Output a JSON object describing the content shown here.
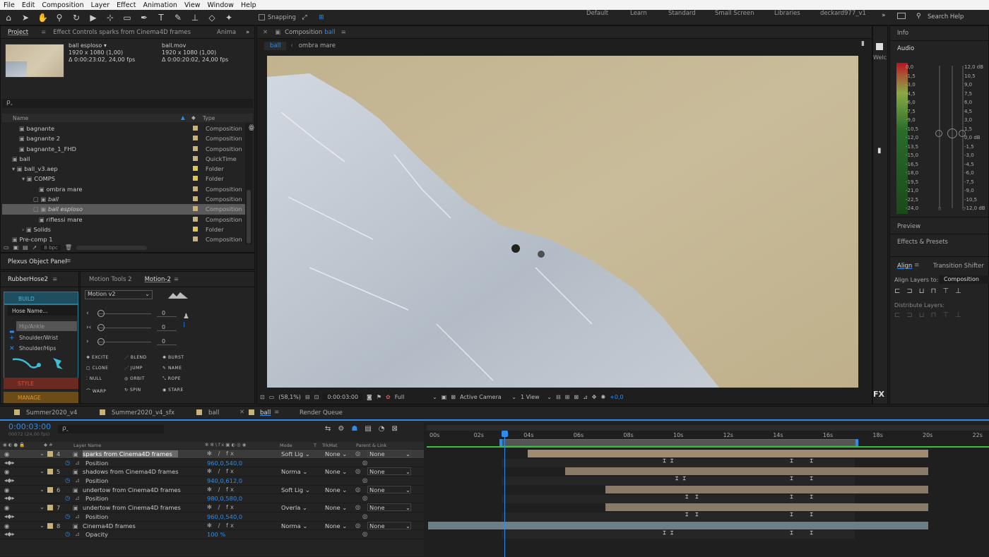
{
  "menu": [
    "File",
    "Edit",
    "Composition",
    "Layer",
    "Effect",
    "Animation",
    "View",
    "Window",
    "Help"
  ],
  "toolbar": {
    "snapping": "Snapping",
    "workspaces": [
      "Default",
      "Learn",
      "Standard",
      "Small Screen",
      "Libraries",
      "deckard977_v1"
    ],
    "search": "Search Help"
  },
  "project": {
    "tab": "Project",
    "effect_tab": "Effect Controls sparks from Cinema4D frames",
    "anim_tab": "Anima",
    "item1": {
      "name": "ball esploso ▾",
      "dims": "1920 x 1080 (1,00)",
      "dur": "Δ 0:00:23:02, 24,00 fps"
    },
    "item2": {
      "name": "ball.mov",
      "dims": "1920 x 1080 (1,00)",
      "dur": "Δ 0:00:20:02, 24,00 fps"
    },
    "search": "ρ‸",
    "col_name": "Name",
    "col_type": "Type",
    "bpc": "8 bpc",
    "rows": [
      {
        "name": "bagnante",
        "type": "Composition",
        "color": "#c7b27a"
      },
      {
        "name": "bagnante 2",
        "type": "Composition",
        "color": "#c7b27a"
      },
      {
        "name": "bagnante_1_FHD",
        "type": "Composition",
        "color": "#c7b27a"
      },
      {
        "name": "ball",
        "type": "QuickTime",
        "color": "#c7b27a"
      },
      {
        "name": "ball_v3.aep",
        "type": "Folder",
        "color": "#e2c54a"
      },
      {
        "name": "COMPS",
        "type": "Folder",
        "color": "#e2c54a"
      },
      {
        "name": "ombra mare",
        "type": "Composition",
        "color": "#c7b27a"
      },
      {
        "name": "ball",
        "type": "Composition",
        "color": "#c7b27a"
      },
      {
        "name": "ball esploso",
        "type": "Composition",
        "color": "#c7b27a"
      },
      {
        "name": "riflessi mare",
        "type": "Composition",
        "color": "#c7b27a"
      },
      {
        "name": "Solids",
        "type": "Folder",
        "color": "#e2c54a"
      },
      {
        "name": "Pre-comp 1",
        "type": "Composition",
        "color": "#c7b27a"
      }
    ]
  },
  "plexus": {
    "title": "Plexus Object Panel"
  },
  "rubberhose": {
    "tab": "RubberHose2",
    "build": "BUILD",
    "hose_name": "Hose Name...",
    "hip": "Hip/Ankle",
    "shoulder_wrist": "Shoulder/Wrist",
    "shoulder_hips": "Shoulder/Hips",
    "style": "STYLE",
    "manage": "MANAGE"
  },
  "motion": {
    "tab1": "Motion Tools 2",
    "tab2": "Motion-2",
    "select": "Motion v2",
    "val1": "0",
    "val2": "0",
    "val3": "0",
    "buttons": [
      "EXCITE",
      "BLEND",
      "BURST",
      "CLONE",
      "JUMP",
      "NAME",
      "NULL",
      "ORBIT",
      "ROPE",
      "WARP",
      "SPIN",
      "STARE"
    ]
  },
  "composition": {
    "tab": "Composition",
    "tab_name": "ball",
    "crumb1": "ball",
    "crumb2": "ombra mare",
    "zoom": "(58,1%)",
    "time": "0:00:03:00",
    "quality": "Full",
    "camera": "Active Camera",
    "view": "1 View",
    "exposure": "+0,0"
  },
  "right": {
    "info": "Info",
    "audio": "Audio",
    "preview": "Preview",
    "effects": "Effects & Presets",
    "align": "Align",
    "transition": "Transition Shifter",
    "align_to_label": "Align Layers to:",
    "align_to": "Composition",
    "distribute": "Distribute Layers:",
    "welc": "Welc",
    "db_left": [
      "0,0",
      "-1,5",
      "-3,0",
      "-4,5",
      "-6,0",
      "-7,5",
      "-9,0",
      "-10,5",
      "-12,0",
      "-13,5",
      "-15,0",
      "-16,5",
      "-18,0",
      "-19,5",
      "-21,0",
      "-22,5",
      "-24,0"
    ],
    "db_right": [
      "12,0 dB",
      "10,5",
      "9,0",
      "7,5",
      "6,0",
      "4,5",
      "3,0",
      "1,5",
      "0,0 dB",
      "-1,5",
      "-3,0",
      "-4,5",
      "-6,0",
      "-7,5",
      "-9,0",
      "-10,5",
      "-12,0 dB"
    ],
    "slider_zero": "0"
  },
  "timeline": {
    "tabs": [
      "Summer2020_v4",
      "Summer2020_v4_sfx",
      "ball",
      "ball",
      "Render Queue"
    ],
    "time": "0:00:03:00",
    "frames": "00072 (24,00 fps)",
    "search": "ρ‸",
    "headers": {
      "layer": "Layer Name",
      "mode": "Mode",
      "t": "T",
      "trkmat": "TrkMat",
      "parent": "Parent & Link"
    },
    "ruler": [
      "00s",
      "02s",
      "04s",
      "06s",
      "08s",
      "10s",
      "12s",
      "14s",
      "16s",
      "18s",
      "20s",
      "22s"
    ],
    "layers": [
      {
        "num": "4",
        "name": "sparks from Cinema4D frames",
        "mode": "Soft Lig",
        "trkmat": "None",
        "parent": "None",
        "prop": "Position",
        "val": "960,0,540,0",
        "selected": true
      },
      {
        "num": "5",
        "name": "shadows from Cinema4D frames",
        "mode": "Norma",
        "trkmat": "None",
        "parent": "None",
        "prop": "Position",
        "val": "940,0,612,0",
        "selected": false
      },
      {
        "num": "6",
        "name": "undertow from Cinema4D frames",
        "mode": "Soft Lig",
        "trkmat": "None",
        "parent": "None",
        "prop": "Position",
        "val": "980,0,580,0",
        "selected": false
      },
      {
        "num": "7",
        "name": "undertow from Cinema4D frames",
        "mode": "Overla",
        "trkmat": "None",
        "parent": "None",
        "prop": "Position",
        "val": "960,0,540,0",
        "selected": false
      },
      {
        "num": "8",
        "name": "Cinema4D frames",
        "mode": "Norma",
        "trkmat": "None",
        "parent": "None",
        "prop": "Opacity",
        "val": "100 %",
        "selected": false
      }
    ],
    "bars": [
      {
        "start": 4.0,
        "end": 20.05,
        "color": "#a08a70"
      },
      {
        "start": 5.5,
        "end": 20.05,
        "color": "#8a7a68"
      },
      {
        "start": 7.1,
        "end": 20.05,
        "color": "#8a7a68"
      },
      {
        "start": 7.1,
        "end": 20.05,
        "color": "#8a7a68"
      },
      {
        "start": 0.0,
        "end": 20.05,
        "color": "#6b7f86"
      }
    ],
    "keyframes": [
      [
        9.5,
        9.8,
        14.6,
        15.4
      ],
      [
        10.0,
        10.3,
        14.6,
        15.4
      ],
      [
        10.4,
        10.8,
        14.6,
        15.4
      ],
      [
        10.4,
        10.8,
        14.6,
        15.4
      ],
      [
        9.5,
        9.8,
        14.6,
        15.4
      ]
    ]
  }
}
